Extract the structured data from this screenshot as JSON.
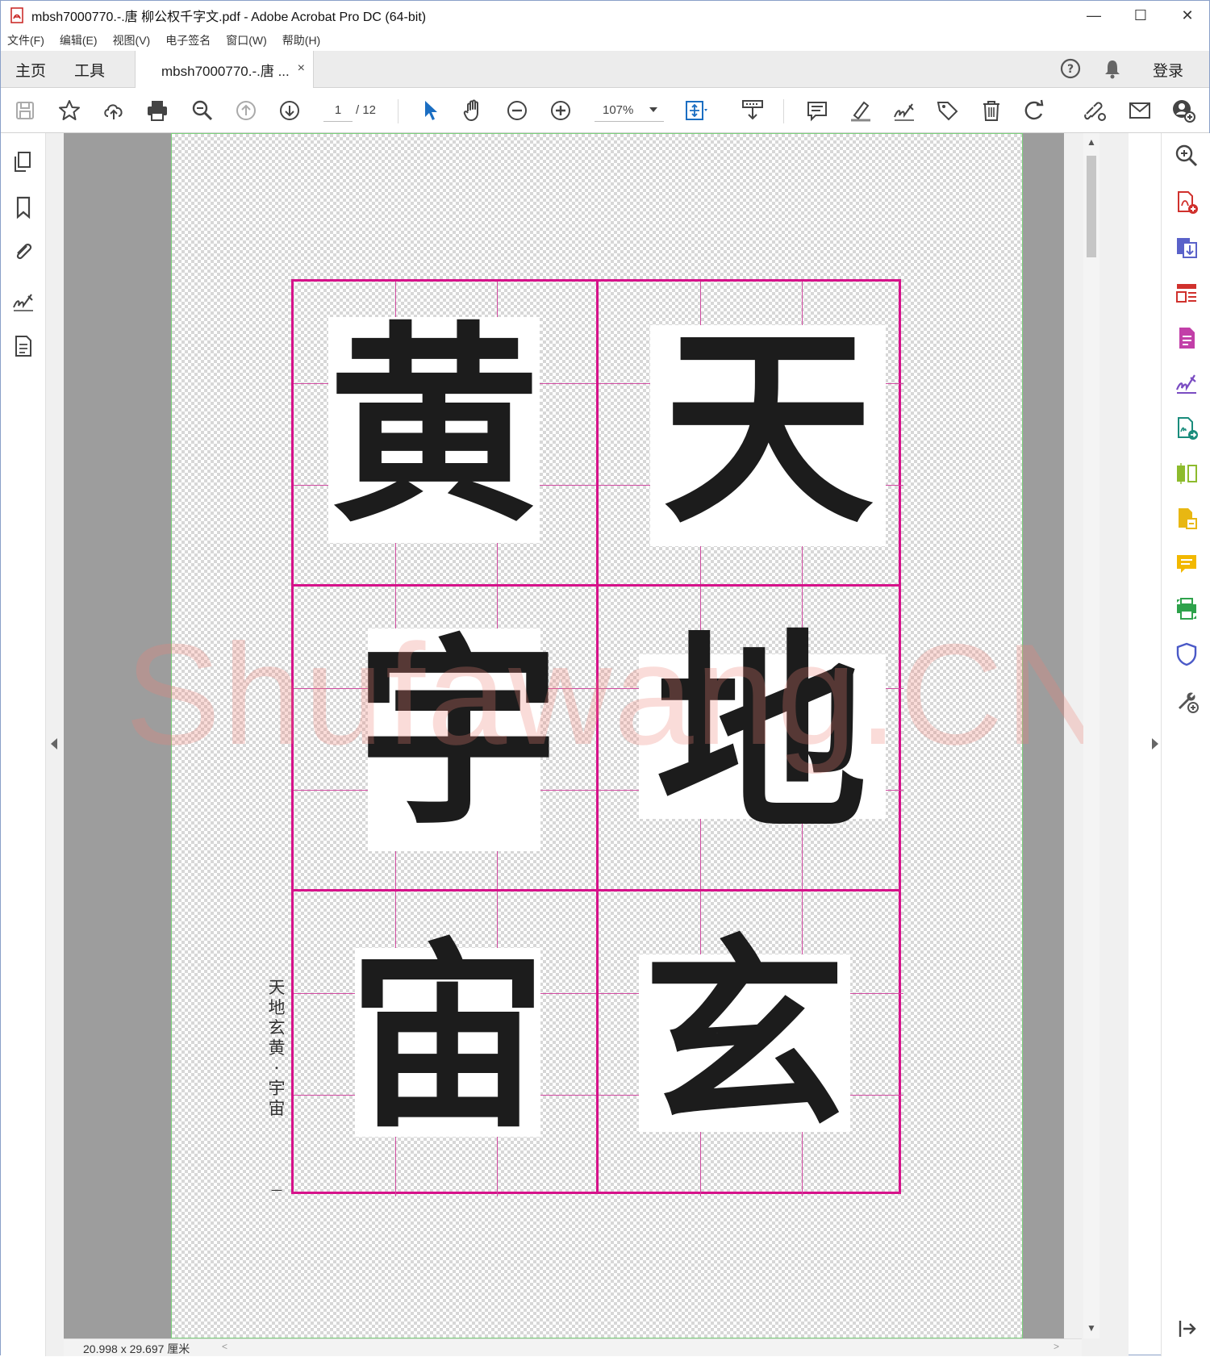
{
  "window": {
    "title": "mbsh7000770.-.唐 柳公权千字文.pdf - Adobe Acrobat Pro DC (64-bit)",
    "minimize": "—",
    "maximize": "☐",
    "close": "✕"
  },
  "menu": [
    "文件(F)",
    "编辑(E)",
    "视图(V)",
    "电子签名",
    "窗口(W)",
    "帮助(H)"
  ],
  "tabs": {
    "home": "主页",
    "tools": "工具",
    "document": "mbsh7000770.-.唐 ...",
    "document_close": "×",
    "login": "登录"
  },
  "toolbar": {
    "page_current": "1",
    "page_total": "/ 12",
    "zoom": "107%",
    "icons": [
      "save-icon",
      "bookmark-star-icon",
      "cloud-upload-icon",
      "print-icon",
      "zoom-search-icon",
      "page-up-icon",
      "page-down-icon",
      "select-cursor-icon",
      "hand-icon",
      "zoom-out-icon",
      "zoom-in-icon",
      "fit-page-icon",
      "scroll-mode-icon",
      "comment-icon",
      "highlight-icon",
      "sign-icon",
      "tag-icon",
      "delete-icon",
      "rotate-icon",
      "share-link-icon",
      "email-icon",
      "add-user-icon"
    ]
  },
  "left_panel": [
    "pages-icon",
    "bookmark-icon",
    "attachment-icon",
    "signature-icon",
    "document-properties-icon"
  ],
  "right_panel": [
    "search-zoom-icon",
    "create-pdf-icon",
    "export-pdf-icon",
    "organize-pages-icon",
    "edit-pdf-icon",
    "fill-sign-icon",
    "send-for-signature-icon",
    "compare-icon",
    "scan-icon",
    "comment-tool-icon",
    "print-production-icon",
    "protect-icon",
    "more-tools-icon",
    "collapse-right-icon"
  ],
  "document": {
    "characters": [
      "天",
      "地",
      "玄",
      "黄",
      "宇",
      "宙"
    ],
    "caption": "天地玄黄 · 宇宙",
    "page_mark": "一",
    "watermark": "Shufawang.CN"
  },
  "status": {
    "dimensions": "20.998 x 29.697 厘米"
  },
  "colors": {
    "grid": "#d6128a",
    "grid_inner": "#d04aa0",
    "page_border": "#7ad07a",
    "watermark": "#ec8076"
  }
}
